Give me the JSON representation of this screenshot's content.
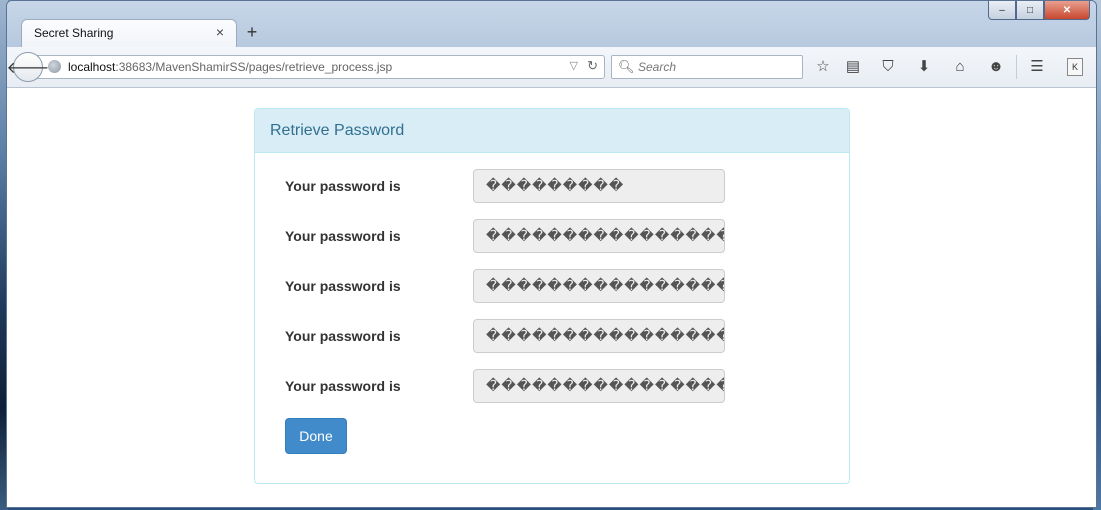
{
  "browser": {
    "tab_title": "Secret Sharing",
    "tab_close": "×",
    "new_tab": "+",
    "url_host": "localhost",
    "url_rest": ":38683/MavenShamirSS/pages/retrieve_process.jsp",
    "search_placeholder": "Search",
    "controls": {
      "minimize": "–",
      "maximize": "□",
      "close": "✕"
    }
  },
  "panel": {
    "title": "Retrieve Password",
    "rows": [
      {
        "label": "Your password is",
        "value": "���������"
      },
      {
        "label": "Your password is",
        "value": "����������������"
      },
      {
        "label": "Your password is",
        "value": "����������������"
      },
      {
        "label": "Your password is",
        "value": "����������������"
      },
      {
        "label": "Your password is",
        "value": "����������������"
      }
    ],
    "done_label": "Done"
  },
  "colors": {
    "panel_heading_bg": "#d9edf7",
    "panel_title": "#31708f",
    "primary_button": "#428bca"
  }
}
